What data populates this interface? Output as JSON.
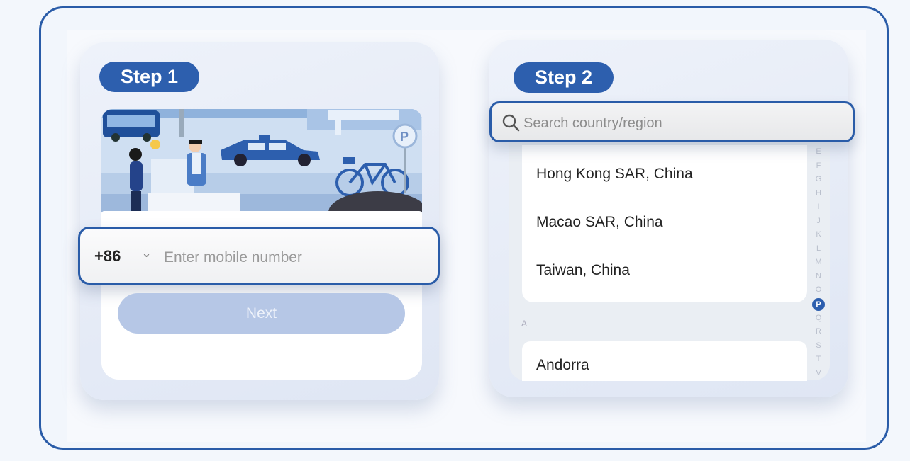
{
  "step1": {
    "label": "Step 1",
    "country_code": "+86",
    "phone_placeholder": "Enter mobile number",
    "next_label": "Next"
  },
  "step2": {
    "label": "Step 2",
    "search_placeholder": "Search country/region",
    "items": [
      "Hong Kong SAR, China",
      "Macao SAR, China",
      "Taiwan, China"
    ],
    "section_header": "A",
    "section_items": [
      "Andorra"
    ],
    "alphabet": [
      "E",
      "F",
      "G",
      "H",
      "I",
      "J",
      "K",
      "L",
      "M",
      "N",
      "O",
      "P",
      "Q",
      "R",
      "S",
      "T",
      "V"
    ],
    "active_letter": "P"
  },
  "colors": {
    "accent": "#2d5fae",
    "border": "#2a5ca8",
    "button_disabled": "#b6c7e6"
  }
}
